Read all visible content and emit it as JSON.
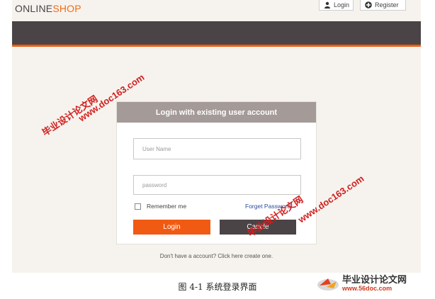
{
  "header": {
    "brand_part1": "ONLINE",
    "brand_part2": "SHOP",
    "login_label": "Login",
    "register_label": "Register"
  },
  "login_panel": {
    "title": "Login with existing user account",
    "username_placeholder": "User Name",
    "password_placeholder": "password",
    "remember_label": "Remember me",
    "forgot_label": "Forget Password",
    "login_button": "Login",
    "cancel_button": "Cancle"
  },
  "signup_text": "Don't have a account? Click here create one.",
  "watermark": {
    "cn_text": "毕业设计论文网",
    "url_text": "www.doc163.com"
  },
  "caption": "图 4-1 系统登录界面",
  "site_logo": {
    "title": "毕业设计论文网",
    "url": "www.56doc.com"
  },
  "colors": {
    "accent": "#ef5e0e",
    "dark": "#4a4446",
    "panel_header": "#a49a98"
  }
}
